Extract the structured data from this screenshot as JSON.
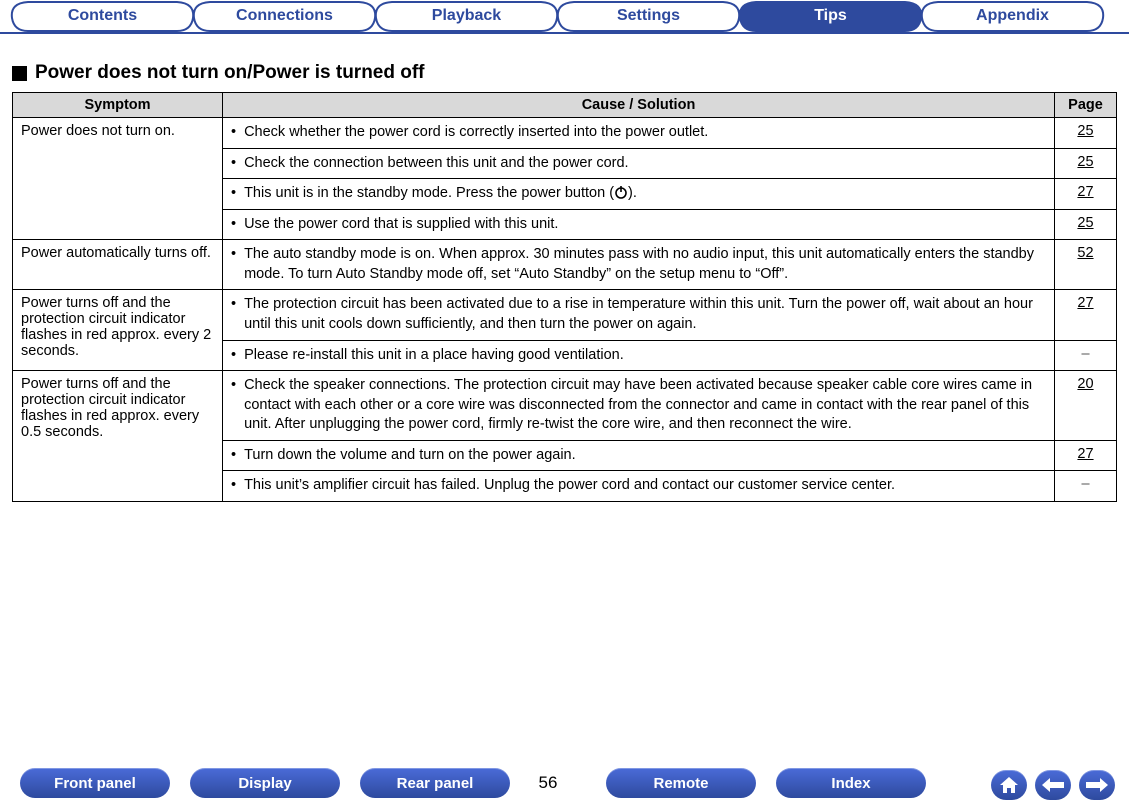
{
  "top_tabs": {
    "items": [
      {
        "label": "Contents",
        "active": false
      },
      {
        "label": "Connections",
        "active": false
      },
      {
        "label": "Playback",
        "active": false
      },
      {
        "label": "Settings",
        "active": false
      },
      {
        "label": "Tips",
        "active": true
      },
      {
        "label": "Appendix",
        "active": false
      }
    ]
  },
  "section": {
    "title": "Power does not turn on/Power is turned off"
  },
  "table": {
    "headers": {
      "symptom": "Symptom",
      "cause": "Cause / Solution",
      "page": "Page"
    },
    "groups": [
      {
        "symptom": "Power does not turn on.",
        "rows": [
          {
            "cause": "Check whether the power cord is correctly inserted into the power outlet.",
            "page": "25"
          },
          {
            "cause": "Check the connection between this unit and the power cord.",
            "page": "25"
          },
          {
            "cause_pre": "This unit is in the standby mode. Press the power button (",
            "cause_post": ").",
            "has_power_icon": true,
            "page": "27"
          },
          {
            "cause": "Use the power cord that is supplied with this unit.",
            "page": "25"
          }
        ]
      },
      {
        "symptom": "Power automatically turns off.",
        "rows": [
          {
            "cause": "The auto standby mode is on. When approx. 30 minutes pass with no audio input, this unit automatically enters the standby mode. To turn Auto Standby mode off, set “Auto Standby” on the setup menu to “Off”.",
            "page": "52"
          }
        ]
      },
      {
        "symptom": "Power turns off and the protection circuit indicator flashes in red approx. every 2 seconds.",
        "rows": [
          {
            "cause": "The protection circuit has been activated due to a rise in temperature within this unit. Turn the power off, wait about an hour until this unit cools down sufficiently, and then turn the power on again.",
            "page": "27"
          },
          {
            "cause": "Please re-install this unit in a place having good ventilation.",
            "page": "–"
          }
        ]
      },
      {
        "symptom": "Power turns off and the protection circuit indicator flashes in red approx. every 0.5 seconds.",
        "rows": [
          {
            "cause": "Check the speaker connections. The protection circuit may have been activated because speaker cable core wires came in contact with each other or a core wire was disconnected from the connector and came in contact with the rear panel of this unit. After unplugging the power cord, firmly re-twist the core wire, and then reconnect the wire.",
            "page": "20"
          },
          {
            "cause": "Turn down the volume and turn on the power again.",
            "page": "27"
          },
          {
            "cause": "This unit’s amplifier circuit has failed. Unplug the power cord and contact our customer service center.",
            "page": "–"
          }
        ]
      }
    ]
  },
  "bottom": {
    "buttons": {
      "front_panel": "Front panel",
      "display": "Display",
      "rear_panel": "Rear panel",
      "remote": "Remote",
      "index": "Index"
    },
    "page_number": "56",
    "icons": {
      "home": "home-icon",
      "prev": "prev-icon",
      "next": "next-icon"
    }
  }
}
